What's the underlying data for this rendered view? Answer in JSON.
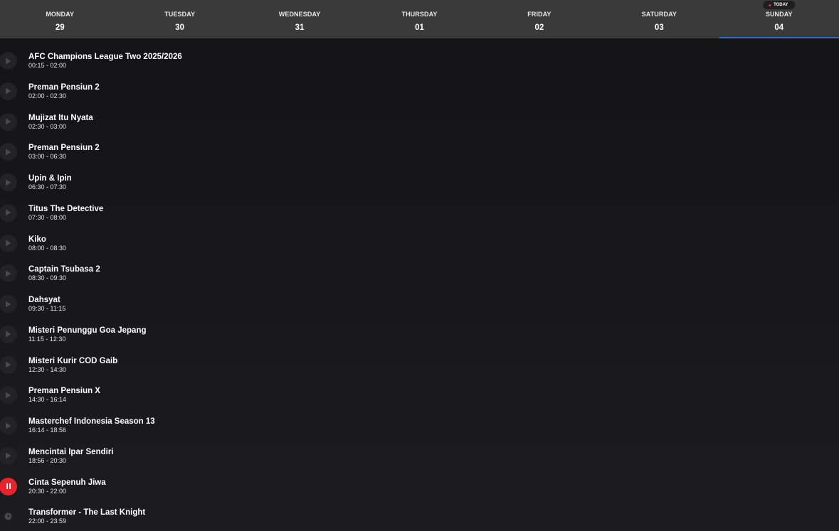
{
  "days": [
    {
      "name": "MONDAY",
      "num": "29"
    },
    {
      "name": "TUESDAY",
      "num": "30"
    },
    {
      "name": "WEDNESDAY",
      "num": "31"
    },
    {
      "name": "THURSDAY",
      "num": "01"
    },
    {
      "name": "FRIDAY",
      "num": "02"
    },
    {
      "name": "SATURDAY",
      "num": "03"
    },
    {
      "name": "SUNDAY",
      "num": "04",
      "badge": "TODAY",
      "active": true
    }
  ],
  "programs": [
    {
      "title": "AFC Champions League Two 2025/2026",
      "time": "00:15 - 02:00",
      "state": "past"
    },
    {
      "title": "Preman Pensiun 2",
      "time": "02:00 - 02:30",
      "state": "past"
    },
    {
      "title": "Mujizat Itu Nyata",
      "time": "02:30 - 03:00",
      "state": "past"
    },
    {
      "title": "Preman Pensiun 2",
      "time": "03:00 - 06:30",
      "state": "past"
    },
    {
      "title": "Upin & Ipin",
      "time": "06:30 - 07:30",
      "state": "past"
    },
    {
      "title": "Titus The Detective",
      "time": "07:30 - 08:00",
      "state": "past"
    },
    {
      "title": "Kiko",
      "time": "08:00 - 08:30",
      "state": "past"
    },
    {
      "title": "Captain Tsubasa 2",
      "time": "08:30 - 09:30",
      "state": "past"
    },
    {
      "title": "Dahsyat",
      "time": "09:30 - 11:15",
      "state": "past"
    },
    {
      "title": "Misteri Penunggu Goa Jepang",
      "time": "11:15 - 12:30",
      "state": "past"
    },
    {
      "title": "Misteri Kurir COD Gaib",
      "time": "12:30 - 14:30",
      "state": "past"
    },
    {
      "title": "Preman Pensiun X",
      "time": "14:30 - 16:14",
      "state": "past"
    },
    {
      "title": "Masterchef Indonesia Season 13",
      "time": "16:14 - 18:56",
      "state": "past"
    },
    {
      "title": "Mencintai Ipar Sendiri",
      "time": "18:56 - 20:30",
      "state": "past"
    },
    {
      "title": "Cinta Sepenuh Jiwa",
      "time": "20:30 - 22:00",
      "state": "live"
    },
    {
      "title": "Transformer - The Last Knight",
      "time": "22:00 - 23:59",
      "state": "upcoming"
    }
  ],
  "colors": {
    "live": "#e8232c",
    "active_tab_underline": "#2b6fd6",
    "today_dot": "#e8362e"
  }
}
